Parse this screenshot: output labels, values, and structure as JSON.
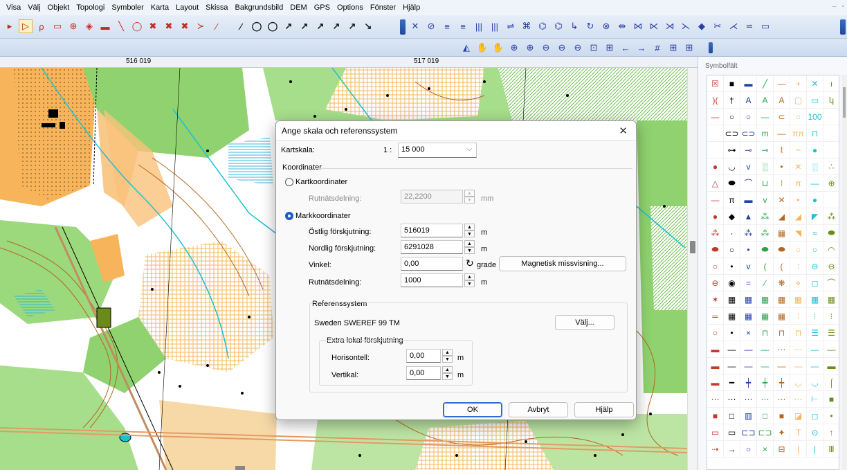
{
  "menu": [
    "Visa",
    "Välj",
    "Objekt",
    "Topologi",
    "Symboler",
    "Karta",
    "Layout",
    "Skissa",
    "Bakgrundsbild",
    "DEM",
    "GPS",
    "Options",
    "Fönster",
    "Hjälp"
  ],
  "window_controls": [
    "–",
    "▫",
    "×"
  ],
  "toolbar1_left": [
    "▸",
    "▷",
    "ρ",
    "▭",
    "⊕",
    "◈",
    "▬",
    "╲",
    "◯",
    "✖",
    "✖",
    "✖",
    "≻",
    "⁄"
  ],
  "toolbar1_mid": [
    "⁄",
    "◯",
    "◯",
    "↗",
    "↗",
    "↗",
    "↗",
    "↗",
    "↘"
  ],
  "toolbar1_right": [
    "✕",
    "⊘",
    "≡",
    "≡",
    "|||",
    "|||",
    "⇌",
    "⌘",
    "⌬",
    "⌬",
    "↳",
    "↻",
    "⊗",
    "⇹",
    "⋈",
    "⋉",
    "⋊",
    "⋋",
    "◆",
    "✂",
    "⋌",
    "⋍",
    "▭"
  ],
  "toolbar2": [
    "◭",
    "✋",
    "✋",
    "⊕",
    "⊕",
    "⊖",
    "⊖",
    "⊖",
    "⊡",
    "⊞",
    "←",
    "→",
    "#",
    "⊞",
    "⊞"
  ],
  "ruler": {
    "left_coord": "516 019",
    "right_coord": "517 019"
  },
  "symbol_panel": {
    "title": "Symbolfält",
    "symbols": [
      "☒",
      "■",
      "▬",
      "╱",
      "—",
      "+",
      "✕",
      "ı",
      ")(",
      "†",
      "A",
      "A",
      "A",
      "▢",
      "▭",
      "կ",
      "—",
      "○",
      "○",
      "—",
      "⊂",
      "○",
      "100",
      "",
      "",
      "⊂⊃",
      "⊂⊃",
      "m",
      "—",
      "ππ",
      "⊓",
      "",
      "",
      "⊶",
      "⊸",
      "⊸",
      "⌇",
      "⌢",
      "●",
      "",
      "●",
      "◡",
      "v",
      "░",
      "•",
      "✕",
      "░",
      "∴",
      "△",
      "⬬",
      "⌒",
      "⊔",
      "⁞",
      "π",
      "—",
      "⊕",
      "―",
      "π",
      "▬",
      "v",
      "✕",
      "•",
      "●",
      "",
      "●",
      "◆",
      "▲",
      "⁂",
      "◢",
      "◢",
      "◤",
      "⁂",
      "⁂",
      "·",
      "⁂",
      "⁂",
      "▦",
      "◥",
      "≈",
      "⬬",
      "⬬",
      "○",
      "•",
      "⬬",
      "⬬",
      "○",
      "○",
      "◠",
      "○",
      "•",
      "v",
      "(",
      "(",
      "⁝",
      "⊖",
      "⊖",
      "⊖",
      "◉",
      "=",
      "⁄",
      "❋",
      "⋄",
      "◻",
      "⌒",
      "✶",
      "▦",
      "▦",
      "▦",
      "▦",
      "▦",
      "▦",
      "▦",
      "═",
      "▦",
      "▦",
      "▦",
      "▦",
      "⁝",
      "⁝",
      "⁝",
      "○",
      "•",
      "×",
      "⊓",
      "⊓",
      "⊓",
      "☰",
      "☰",
      "▬",
      "—",
      "—",
      "—",
      "⋯",
      "⋯",
      "—",
      "—",
      "▬",
      "—",
      "—",
      "—",
      "—",
      "—",
      "—",
      "▬",
      "▬",
      "━",
      "┿",
      "┿",
      "┿",
      "◡",
      "◡",
      "⌠",
      "⋯",
      "⋯",
      "⋯",
      "⋯",
      "⋯",
      "⋯",
      "⊢",
      "■",
      "■",
      "□",
      "▥",
      "□",
      "■",
      "◪",
      "◻",
      "•",
      "▭",
      "▭",
      "⊏⊐",
      "⊏⊐",
      "✦",
      "T",
      "⊙",
      "↑",
      "⇢",
      "→",
      "○",
      "×",
      "⊟",
      "|",
      "|",
      "Ⅲ"
    ]
  },
  "dialog": {
    "title": "Ange skala och referenssystem",
    "close": "✕",
    "scale_label": "Kartskala:",
    "scale_prefix": "1 :",
    "scale_value": "15 000",
    "coordinates_group": "Koordinater",
    "map_coords_label": "Kartkoordinater",
    "grid_spacing_label_disabled": "Rutnätsdelning:",
    "grid_spacing_value_disabled": "22,2200",
    "mm_unit": "mm",
    "ground_coords_label": "Markkoordinater",
    "east_offset_label": "Östlig förskjutning:",
    "east_offset_value": "516019",
    "north_offset_label": "Nordlig förskjutning:",
    "north_offset_value": "6291028",
    "angle_label": "Vinkel:",
    "angle_value": "0,00",
    "angle_unit": "grade",
    "grid_spacing_label": "Rutnätsdelning:",
    "grid_spacing_value": "1000",
    "m_unit": "m",
    "magnetic_button": "Magnetisk missvisning...",
    "reference_group": "Referenssystem",
    "reference_value": "Sweden  SWEREF 99 TM",
    "choose_button": "Välj...",
    "extra_group": "Extra lokal förskjutning",
    "horizontal_label": "Horisontell:",
    "horizontal_value": "0,00",
    "vertical_label": "Vertikal:",
    "vertical_value": "0,00",
    "ok_button": "OK",
    "cancel_button": "Avbryt",
    "help_button": "Hjälp"
  },
  "colors": {
    "accent": "#1a5fc7",
    "map_orange": "#f7b45a",
    "map_green": "#8fd26f",
    "map_contour": "#b5651d",
    "map_water": "#1ec0d0"
  }
}
